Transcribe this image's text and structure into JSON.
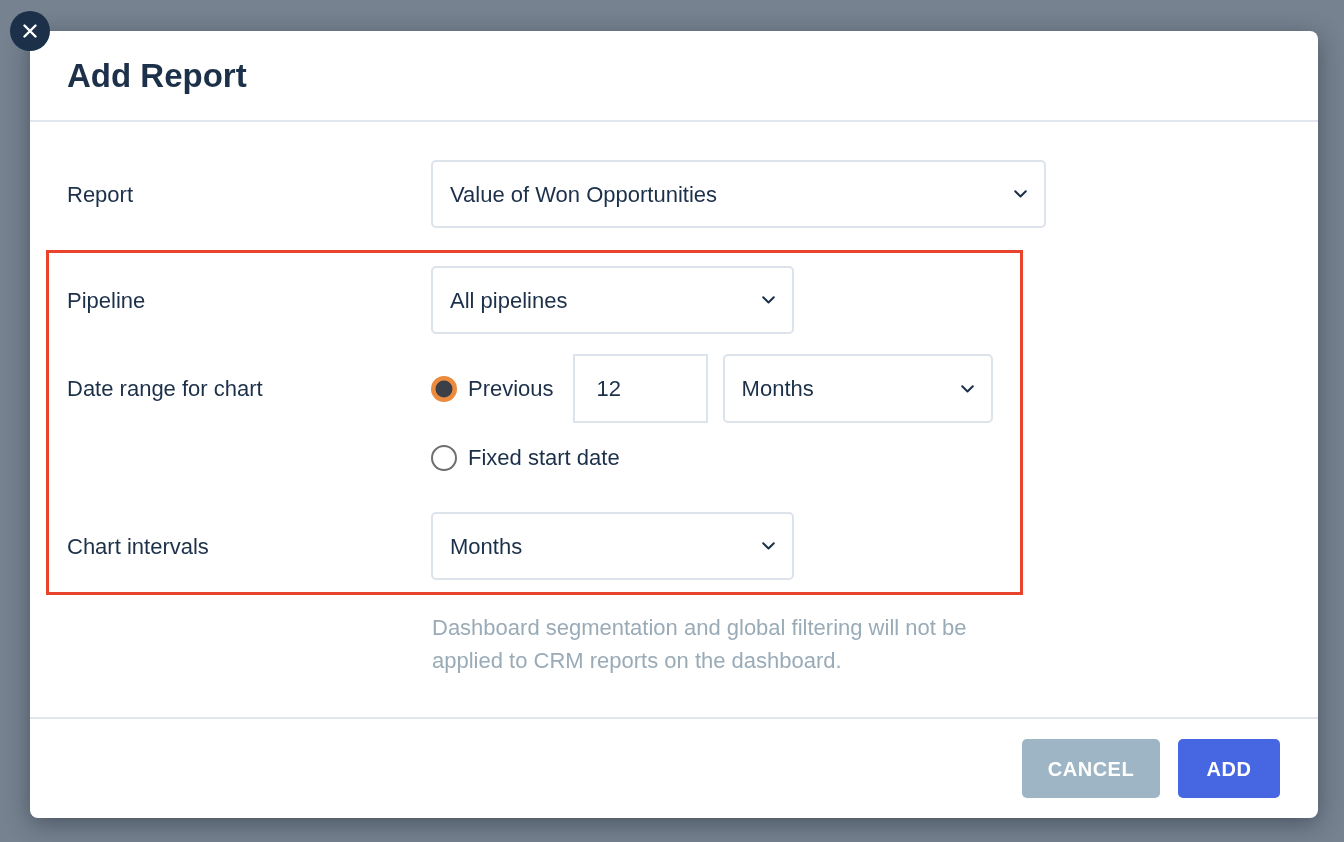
{
  "dialog": {
    "title": "Add Report"
  },
  "form": {
    "rows": [
      {
        "label": "Report",
        "kind": "select",
        "value": "Value of Won Opportunities",
        "highlighted": false
      },
      {
        "label": "Pipeline",
        "kind": "select",
        "value": "All pipelines",
        "highlighted": true
      },
      {
        "label": "Date range for chart",
        "kind": "date_range",
        "highlighted": true,
        "options": [
          {
            "label": "Previous",
            "selected": true,
            "count": "12",
            "unit": "Months"
          },
          {
            "label": "Fixed start date",
            "selected": false
          }
        ]
      },
      {
        "label": "Chart intervals",
        "kind": "select",
        "value": "Months",
        "highlighted": true
      }
    ],
    "note": "Dashboard segmentation and global filtering will not be applied to CRM reports on the dashboard."
  },
  "buttons": [
    {
      "label": "CANCEL",
      "kind": "secondary"
    },
    {
      "label": "ADD",
      "kind": "primary"
    }
  ]
}
